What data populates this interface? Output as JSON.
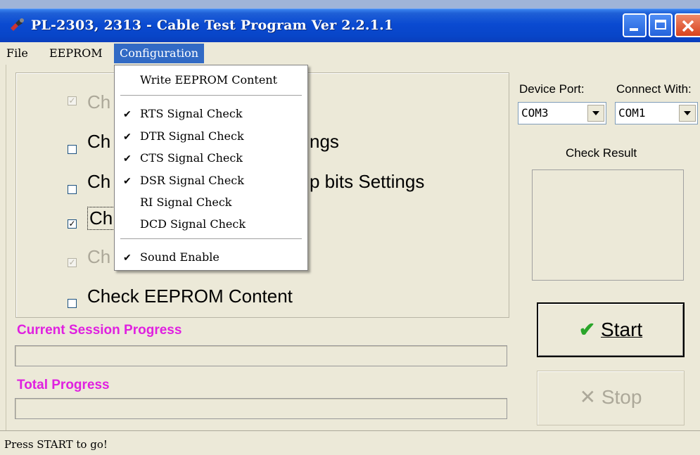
{
  "window": {
    "title": "PL-2303, 2313 - Cable Test Program Ver 2.2.1.1",
    "icon": "usb-cable-icon"
  },
  "menubar": {
    "file": "File",
    "eeprom": "EEPROM",
    "configuration": "Configuration"
  },
  "configuration_menu": {
    "items": [
      {
        "label": "Write EEPROM Content",
        "checked": false
      },
      {
        "label": "RTS Signal Check",
        "checked": true
      },
      {
        "label": "DTR Signal Check",
        "checked": true
      },
      {
        "label": "CTS Signal Check",
        "checked": true
      },
      {
        "label": "DSR Signal Check",
        "checked": true
      },
      {
        "label": "RI Signal Check",
        "checked": false
      },
      {
        "label": "DCD Signal Check",
        "checked": false
      },
      {
        "label": "Sound Enable",
        "checked": true
      }
    ]
  },
  "options": {
    "row1": {
      "visible_text": "Ch",
      "checked": true,
      "enabled": false
    },
    "row2": {
      "visible_text": "Ch",
      "trailing": "ngs",
      "checked": false,
      "enabled": true
    },
    "row3": {
      "visible_text": "Ch",
      "trailing": "p bits Settings",
      "checked": false,
      "enabled": true
    },
    "row4": {
      "visible_text": "Ch",
      "checked": true,
      "enabled": true
    },
    "row5": {
      "visible_text": "Ch",
      "checked": true,
      "enabled": false
    },
    "row6": {
      "visible_text": "Check EEPROM Content",
      "checked": false,
      "enabled": true
    }
  },
  "progress": {
    "current_label": "Current Session Progress",
    "current_value": 0,
    "total_label": "Total Progress",
    "total_value": 0
  },
  "ports": {
    "device_port_label": "Device Port:",
    "device_port_value": "COM3",
    "connect_with_label": "Connect With:",
    "connect_with_value": "COM1"
  },
  "result": {
    "label": "Check Result"
  },
  "buttons": {
    "start": "Start",
    "stop": "Stop"
  },
  "status": {
    "text": "Press START to go!"
  },
  "colors": {
    "titlebar": "#0a4ad1",
    "progress_label": "#e020e0",
    "menu_highlight": "#316ac5",
    "check_green": "#21a121"
  }
}
